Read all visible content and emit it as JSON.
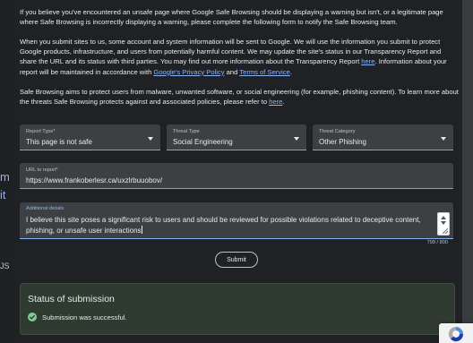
{
  "intro": {
    "p1": "If you believe you've encountered an unsafe page where Google Safe Browsing should be displaying a warning but isn't, or a legitimate page where Safe Browsing is incorrectly displaying a warning, please complete the following form to notify the Safe Browsing team.",
    "p2_a": "When you submit sites to us, some account and system information will be sent to Google. We will use the information you submit to protect Google products, infrastructure, and users from potentially harmful content. We may update the site's status in our Transparency Report and share the URL and its status with third parties. You may find out more information about the Transparency Report ",
    "p2_link_here": "here",
    "p2_b": ". Information about your report will be maintained in accordance with ",
    "p2_link_privacy": "Google's Privacy Policy",
    "p2_c": " and ",
    "p2_link_terms": "Terms of Service",
    "p2_d": ".",
    "p3_a": "Safe Browsing aims to protect users from malware, unwanted software, or social engineering (for example, phishing content). To learn more about the threats Safe Browsing protects against and associated policies, please refer to ",
    "p3_link_here": "here",
    "p3_b": "."
  },
  "form": {
    "report_type": {
      "label": "Report Type*",
      "value": "This page is not safe"
    },
    "threat_type": {
      "label": "Threat Type",
      "value": "Social Engineering"
    },
    "threat_category": {
      "label": "Threat Category",
      "value": "Other Phishing"
    },
    "url": {
      "label": "URL to report*",
      "value": "https://www.frankoberlesr.ca/uxzlrbuuobov/"
    },
    "details": {
      "label": "Additional details",
      "value": "I believe this site poses a significant risk to users and should be reviewed for possible violations related to deceptive content, phishing, or unsafe user interactions",
      "counter": "799 / 800"
    },
    "submit_label": "Submit"
  },
  "status": {
    "title": "Status of submission",
    "message": "Submission was successful."
  },
  "background_fragments": {
    "a": "m",
    "b": "it",
    "c": "JS"
  },
  "colors": {
    "panel": "#202124",
    "field": "#3c4043",
    "link": "#8ab4f8",
    "success_bg": "#2f3a30",
    "success_icon": "#81c995"
  }
}
